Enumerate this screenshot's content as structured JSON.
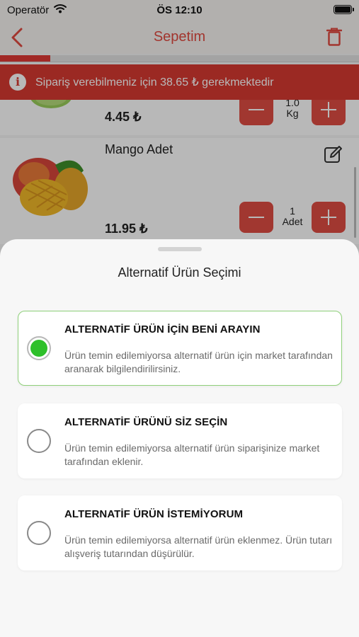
{
  "status_bar": {
    "carrier": "Operatör",
    "time": "ÖS 12:10"
  },
  "nav": {
    "title": "Sepetim",
    "back_icon": "chevron-left-icon",
    "trash_icon": "trash-icon"
  },
  "progress": {
    "fraction": 0.14
  },
  "alert": {
    "icon": "info-icon",
    "icon_glyph": "i",
    "message": "Sipariş verebilmeniz için 38.65 ₺ gerekmektedir"
  },
  "cart": {
    "items": [
      {
        "name": "",
        "price": "4.45 ₺",
        "qty_value": "1.0",
        "qty_unit": "Kg"
      },
      {
        "name": "Mango Adet",
        "price": "11.95 ₺",
        "qty_value": "1",
        "qty_unit": "Adet"
      }
    ]
  },
  "sheet": {
    "title": "Alternatif Ürün Seçimi",
    "options": [
      {
        "title": "ALTERNATİF ÜRÜN İÇİN BENİ ARAYIN",
        "description": "Ürün temin edilemiyorsa alternatif ürün için market tarafından aranarak bilgilendirilirsiniz.",
        "selected": true
      },
      {
        "title": "ALTERNATİF ÜRÜNÜ SİZ SEÇİN",
        "description": "Ürün temin edilemiyorsa alternatif ürün siparişinize market tarafından eklenir.",
        "selected": false
      },
      {
        "title": "ALTERNATİF ÜRÜN İSTEMİYORUM",
        "description": "Ürün temin edilemiyorsa alternatif ürün eklenmez. Ürün tutarı alışveriş tutarından düşürülür.",
        "selected": false
      }
    ]
  },
  "colors": {
    "accent": "#e14a40",
    "alert_bg": "#d73a31",
    "selected_green": "#2ec02a",
    "selected_border": "#8fd07a"
  }
}
